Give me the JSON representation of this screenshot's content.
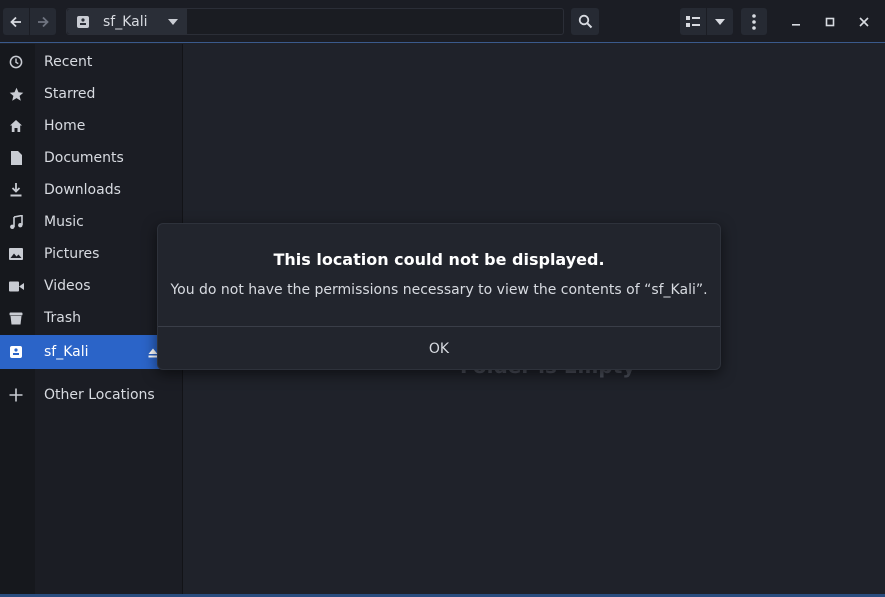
{
  "headerbar": {
    "path_label": "sf_Kali",
    "icons": {
      "back": "arrow-left-icon",
      "forward": "arrow-right-icon",
      "drive": "drive-icon",
      "path_menu": "caret-down-icon",
      "search": "search-icon",
      "view": "list-view-icon",
      "view_menu": "caret-down-icon",
      "menu": "kebab-menu-icon",
      "minimize": "minimize-icon",
      "maximize": "maximize-icon",
      "close": "close-icon"
    }
  },
  "sidebar": {
    "items": [
      {
        "label": "Recent",
        "icon": "clock-icon"
      },
      {
        "label": "Starred",
        "icon": "star-icon"
      },
      {
        "label": "Home",
        "icon": "home-icon"
      },
      {
        "label": "Documents",
        "icon": "document-icon"
      },
      {
        "label": "Downloads",
        "icon": "download-icon"
      },
      {
        "label": "Music",
        "icon": "music-icon"
      },
      {
        "label": "Pictures",
        "icon": "picture-icon"
      },
      {
        "label": "Videos",
        "icon": "video-icon"
      },
      {
        "label": "Trash",
        "icon": "trash-icon"
      },
      {
        "label": "sf_Kali",
        "icon": "drive-icon",
        "active": true
      },
      {
        "label": "Other Locations",
        "icon": "plus-icon"
      }
    ]
  },
  "content": {
    "empty_label": "Folder is Empty"
  },
  "dialog": {
    "title": "This location could not be displayed.",
    "message": "You do not have the permissions necessary to view the contents of “sf_Kali”.",
    "ok_label": "OK"
  },
  "colors": {
    "accent": "#2b64c8",
    "background": "#1f222a",
    "sidebar": "#1b1d24"
  }
}
